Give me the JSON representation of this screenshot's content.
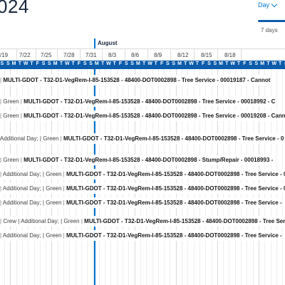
{
  "header": {
    "year_fragment": "024",
    "view_label": "Day",
    "range_label": "7 days"
  },
  "timeline": {
    "month_label": "August",
    "week_labels": [
      "/19",
      "7/22",
      "7/25",
      "7/28",
      "7/31",
      "8/3",
      "8/6",
      "8/9",
      "8/12",
      "8/15",
      "8/18"
    ],
    "day_letters": [
      "S",
      "S",
      "M",
      "T",
      "W",
      "T",
      "F",
      "S",
      "S",
      "M",
      "T",
      "W",
      "T",
      "F",
      "S",
      "S",
      "M",
      "T",
      "W",
      "T",
      "F",
      "S",
      "S",
      "M",
      "T",
      "W",
      "T",
      "F",
      "S",
      "S",
      "M",
      "T",
      "W",
      "T",
      "F",
      "S",
      "S",
      "M",
      "T",
      "W",
      "T",
      "F",
      "S",
      "S",
      "M",
      "T",
      "W",
      "T",
      "F",
      "S"
    ]
  },
  "events": [
    {
      "prefix": "",
      "main": "MULTI-GDOT - T32-D1-VegRem-I-85-153528 - 48400-DOT0002898 - Tree Service - 00019187 - Cannot"
    },
    {
      "prefix": "Green",
      "main": "MULTI-GDOT - T32-D1-VegRem-I-85-153528 - 48400-DOT0002898 - Tree Service - 00018992 - C"
    },
    {
      "prefix": "Green",
      "main": "MULTI-GDOT - T32-D1-VegRem-I-85-153528 - 48400-DOT0002898 - Tree Service - 00019208 - Canno"
    },
    {
      "prefix": "Additional Day; | Green",
      "main": "MULTI-GDOT - T32-D1-VegRem-I-85-153528 - 48400-DOT0002898 - Tree Service - 0"
    },
    {
      "prefix": "Green",
      "main": "MULTI-GDOT - T32-D1-VegRem-I-85-153528 - 48400-DOT0002898 - Stump/Repair - 00018993 -"
    },
    {
      "prefix": "Additional Day; | Green",
      "main": "MULTI-GDOT - T32-D1-VegRem-I-85-153528 - 48400-DOT0002898 - Tree Service - 00"
    },
    {
      "prefix": "Additional Day; | Green",
      "main": "MULTI-GDOT - T32-D1-VegRem-I-85-153528 - 48400-DOT0002898 - Tree Service - 0"
    },
    {
      "prefix": "Additional Day; | Green",
      "main": "MULTI-GDOT - T32-D1-VegRem-I-85-153528 - 48400-DOT0002898 - Tree Service -"
    },
    {
      "prefix": "Crew | Additional Day; | Green",
      "main": "MULTI-GDOT - T32-D1-VegRem-I-85-153528 - 48400-DOT0002898 - Tree Ser"
    },
    {
      "prefix": "Additional Day; | Green",
      "main": "MULTI-GDOT - T32-D1-VegRem-I-85-153528 - 48400-DOT0002898 - Tree Service -"
    }
  ],
  "colors": {
    "accent": "#0176d3",
    "day_header_bg": "#0b5cab"
  }
}
